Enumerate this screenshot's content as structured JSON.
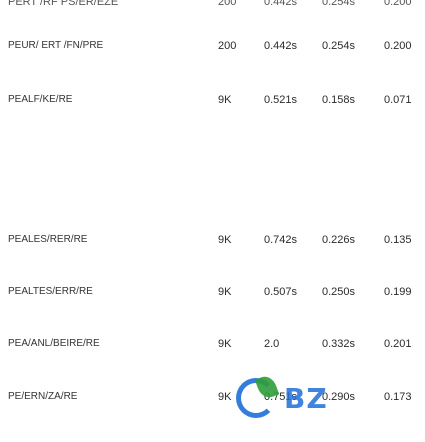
{
  "top_row": {
    "name": "PERT /RF PS/ER/EZE",
    "count": "200",
    "v1": "0.442s",
    "v2": "0.254s",
    "v3": "0.200"
  },
  "rows": [
    {
      "name": "PEUR/ ERT /FN/PRE",
      "count": "200",
      "v1": "0.442s",
      "v2": "0.254s",
      "v3": "0.200"
    },
    {
      "name": "PEALF/KE/RE",
      "count": "9K",
      "v1": "0.521s",
      "v2": "0.158s",
      "v3": "0.071"
    },
    {
      "name": "PEALES/RER/RE",
      "count": "9K",
      "v1": "0.742s",
      "v2": "0.226s",
      "v3": "0.135"
    },
    {
      "name": "PEALTES/ERR/RE",
      "count": "9K",
      "v1": "0.507s",
      "v2": "0.250s",
      "v3": "0.199"
    },
    {
      "name": "PEA/ANL/BEIRE/RE",
      "count": "9K",
      "v1": "2.0",
      "v2": "0.332s",
      "v3": "0.201"
    },
    {
      "name": "PE/ERN/ZA/RE",
      "count": "9K",
      "v1": "0.751s",
      "v2": "0.290s",
      "v3": "0.173"
    }
  ],
  "watermark": {
    "label": "BZ"
  }
}
